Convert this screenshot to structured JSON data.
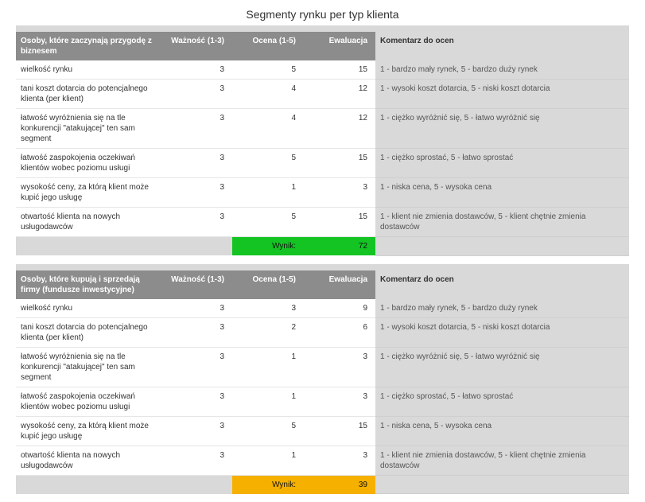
{
  "title": "Segmenty rynku per typ klienta",
  "columns": {
    "waznosc": "Ważność (1-3)",
    "ocena": "Ocena (1-5)",
    "ewaluacja": "Ewaluacja",
    "komentarz": "Komentarz do ocen"
  },
  "result_label": "Wynik:",
  "segments": [
    {
      "name": "Osoby, które zaczynają przygodę z biznesem",
      "result": 72,
      "result_class": "res-green",
      "rows": [
        {
          "crit": "wielkość rynku",
          "waz": 3,
          "oc": 5,
          "ev": 15,
          "kom": "1 - bardzo mały rynek, 5 - bardzo duży rynek"
        },
        {
          "crit": "tani koszt dotarcia do potencjalnego klienta (per klient)",
          "waz": 3,
          "oc": 4,
          "ev": 12,
          "kom": "1 - wysoki koszt dotarcia, 5 - niski koszt dotarcia"
        },
        {
          "crit": "łatwość wyróżnienia się na tle konkurencji \"atakującej\" ten sam segment",
          "waz": 3,
          "oc": 4,
          "ev": 12,
          "kom": "1 - ciężko wyróżnić się, 5 - łatwo wyróżnić się"
        },
        {
          "crit": "łatwość zaspokojenia oczekiwań klientów wobec poziomu usługi",
          "waz": 3,
          "oc": 5,
          "ev": 15,
          "kom": "1 - ciężko sprostać, 5 - łatwo sprostać"
        },
        {
          "crit": "wysokość ceny, za którą klient może kupić jego usługę",
          "waz": 3,
          "oc": 1,
          "ev": 3,
          "kom": "1 - niska cena, 5 - wysoka cena"
        },
        {
          "crit": "otwartość klienta na nowych usługodawców",
          "waz": 3,
          "oc": 5,
          "ev": 15,
          "kom": "1 - klient nie zmienia dostawców, 5 - klient chętnie zmienia dostawców"
        }
      ]
    },
    {
      "name": "Osoby, które kupują i sprzedają firmy (fundusze inwestycyjne)",
      "result": 39,
      "result_class": "res-orange",
      "rows": [
        {
          "crit": "wielkość rynku",
          "waz": 3,
          "oc": 3,
          "ev": 9,
          "kom": "1 - bardzo mały rynek, 5 - bardzo duży rynek"
        },
        {
          "crit": "tani koszt dotarcia do potencjalnego klienta (per klient)",
          "waz": 3,
          "oc": 2,
          "ev": 6,
          "kom": "1 - wysoki koszt dotarcia, 5 - niski koszt dotarcia"
        },
        {
          "crit": "łatwość wyróżnienia się na tle konkurencji \"atakującej\" ten sam segment",
          "waz": 3,
          "oc": 1,
          "ev": 3,
          "kom": "1 - ciężko wyróżnić się, 5 - łatwo wyróżnić się"
        },
        {
          "crit": "łatwość zaspokojenia oczekiwań klientów wobec poziomu usługi",
          "waz": 3,
          "oc": 1,
          "ev": 3,
          "kom": "1 - ciężko sprostać, 5 - łatwo sprostać"
        },
        {
          "crit": "wysokość ceny, za którą klient może kupić jego usługę",
          "waz": 3,
          "oc": 5,
          "ev": 15,
          "kom": "1 - niska cena, 5 - wysoka cena"
        },
        {
          "crit": "otwartość klienta na nowych usługodawców",
          "waz": 3,
          "oc": 1,
          "ev": 3,
          "kom": "1 - klient nie zmienia dostawców, 5 - klient chętnie zmienia dostawców"
        }
      ]
    }
  ]
}
